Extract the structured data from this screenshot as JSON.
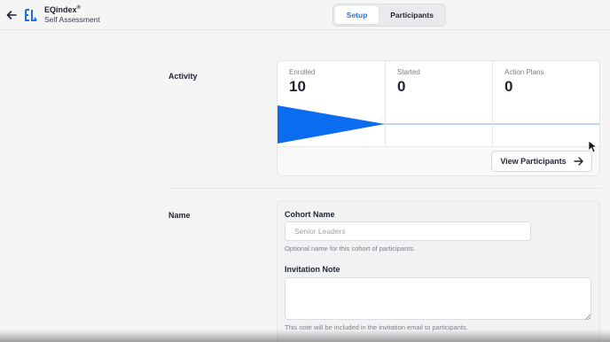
{
  "header": {
    "app_title": "EQindex",
    "app_title_mark": "®",
    "app_subtitle": "Self Assessment",
    "back_icon": "arrow-left-icon",
    "logo_icon": "eq-logo-icon",
    "tabs": [
      {
        "label": "Setup",
        "active": true
      },
      {
        "label": "Participants",
        "active": false
      }
    ]
  },
  "activity": {
    "section_label": "Activity",
    "stats": [
      {
        "label": "Enrolled",
        "value": "10"
      },
      {
        "label": "Started",
        "value": "0"
      },
      {
        "label": "Action Plans",
        "value": "0"
      }
    ],
    "funnel_color": "#0b6cf0",
    "view_button_label": "View Participants",
    "view_button_icon": "arrow-right-icon"
  },
  "name_section": {
    "section_label": "Name",
    "cohort_name_label": "Cohort Name",
    "cohort_name_placeholder": "Senior Leaders",
    "cohort_name_value": "",
    "cohort_name_hint": "Optional name for this cohort of participants.",
    "invitation_note_label": "Invitation Note",
    "invitation_note_value": "",
    "invitation_note_hint": "This note will be included in the invitation email to participants."
  },
  "colors": {
    "accent": "#2f6fd6",
    "funnel": "#0b6cf0",
    "background": "#f5f5f6"
  }
}
